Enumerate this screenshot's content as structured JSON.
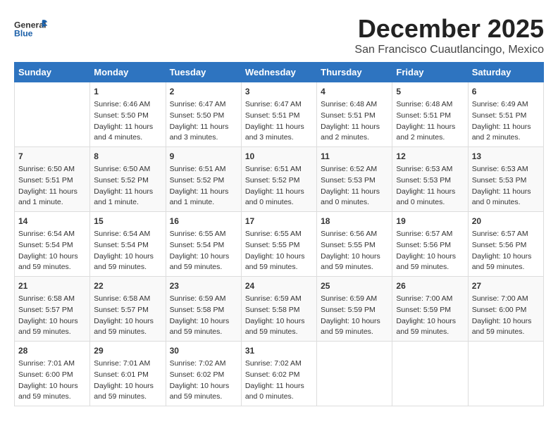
{
  "header": {
    "logo_general": "General",
    "logo_blue": "Blue",
    "month": "December 2025",
    "location": "San Francisco Cuautlancingo, Mexico"
  },
  "columns": [
    "Sunday",
    "Monday",
    "Tuesday",
    "Wednesday",
    "Thursday",
    "Friday",
    "Saturday"
  ],
  "weeks": [
    [
      {
        "day": "",
        "info": ""
      },
      {
        "day": "1",
        "info": "Sunrise: 6:46 AM\nSunset: 5:50 PM\nDaylight: 11 hours\nand 4 minutes."
      },
      {
        "day": "2",
        "info": "Sunrise: 6:47 AM\nSunset: 5:50 PM\nDaylight: 11 hours\nand 3 minutes."
      },
      {
        "day": "3",
        "info": "Sunrise: 6:47 AM\nSunset: 5:51 PM\nDaylight: 11 hours\nand 3 minutes."
      },
      {
        "day": "4",
        "info": "Sunrise: 6:48 AM\nSunset: 5:51 PM\nDaylight: 11 hours\nand 2 minutes."
      },
      {
        "day": "5",
        "info": "Sunrise: 6:48 AM\nSunset: 5:51 PM\nDaylight: 11 hours\nand 2 minutes."
      },
      {
        "day": "6",
        "info": "Sunrise: 6:49 AM\nSunset: 5:51 PM\nDaylight: 11 hours\nand 2 minutes."
      }
    ],
    [
      {
        "day": "7",
        "info": "Sunrise: 6:50 AM\nSunset: 5:51 PM\nDaylight: 11 hours\nand 1 minute."
      },
      {
        "day": "8",
        "info": "Sunrise: 6:50 AM\nSunset: 5:52 PM\nDaylight: 11 hours\nand 1 minute."
      },
      {
        "day": "9",
        "info": "Sunrise: 6:51 AM\nSunset: 5:52 PM\nDaylight: 11 hours\nand 1 minute."
      },
      {
        "day": "10",
        "info": "Sunrise: 6:51 AM\nSunset: 5:52 PM\nDaylight: 11 hours\nand 0 minutes."
      },
      {
        "day": "11",
        "info": "Sunrise: 6:52 AM\nSunset: 5:53 PM\nDaylight: 11 hours\nand 0 minutes."
      },
      {
        "day": "12",
        "info": "Sunrise: 6:53 AM\nSunset: 5:53 PM\nDaylight: 11 hours\nand 0 minutes."
      },
      {
        "day": "13",
        "info": "Sunrise: 6:53 AM\nSunset: 5:53 PM\nDaylight: 11 hours\nand 0 minutes."
      }
    ],
    [
      {
        "day": "14",
        "info": "Sunrise: 6:54 AM\nSunset: 5:54 PM\nDaylight: 10 hours\nand 59 minutes."
      },
      {
        "day": "15",
        "info": "Sunrise: 6:54 AM\nSunset: 5:54 PM\nDaylight: 10 hours\nand 59 minutes."
      },
      {
        "day": "16",
        "info": "Sunrise: 6:55 AM\nSunset: 5:54 PM\nDaylight: 10 hours\nand 59 minutes."
      },
      {
        "day": "17",
        "info": "Sunrise: 6:55 AM\nSunset: 5:55 PM\nDaylight: 10 hours\nand 59 minutes."
      },
      {
        "day": "18",
        "info": "Sunrise: 6:56 AM\nSunset: 5:55 PM\nDaylight: 10 hours\nand 59 minutes."
      },
      {
        "day": "19",
        "info": "Sunrise: 6:57 AM\nSunset: 5:56 PM\nDaylight: 10 hours\nand 59 minutes."
      },
      {
        "day": "20",
        "info": "Sunrise: 6:57 AM\nSunset: 5:56 PM\nDaylight: 10 hours\nand 59 minutes."
      }
    ],
    [
      {
        "day": "21",
        "info": "Sunrise: 6:58 AM\nSunset: 5:57 PM\nDaylight: 10 hours\nand 59 minutes."
      },
      {
        "day": "22",
        "info": "Sunrise: 6:58 AM\nSunset: 5:57 PM\nDaylight: 10 hours\nand 59 minutes."
      },
      {
        "day": "23",
        "info": "Sunrise: 6:59 AM\nSunset: 5:58 PM\nDaylight: 10 hours\nand 59 minutes."
      },
      {
        "day": "24",
        "info": "Sunrise: 6:59 AM\nSunset: 5:58 PM\nDaylight: 10 hours\nand 59 minutes."
      },
      {
        "day": "25",
        "info": "Sunrise: 6:59 AM\nSunset: 5:59 PM\nDaylight: 10 hours\nand 59 minutes."
      },
      {
        "day": "26",
        "info": "Sunrise: 7:00 AM\nSunset: 5:59 PM\nDaylight: 10 hours\nand 59 minutes."
      },
      {
        "day": "27",
        "info": "Sunrise: 7:00 AM\nSunset: 6:00 PM\nDaylight: 10 hours\nand 59 minutes."
      }
    ],
    [
      {
        "day": "28",
        "info": "Sunrise: 7:01 AM\nSunset: 6:00 PM\nDaylight: 10 hours\nand 59 minutes."
      },
      {
        "day": "29",
        "info": "Sunrise: 7:01 AM\nSunset: 6:01 PM\nDaylight: 10 hours\nand 59 minutes."
      },
      {
        "day": "30",
        "info": "Sunrise: 7:02 AM\nSunset: 6:02 PM\nDaylight: 10 hours\nand 59 minutes."
      },
      {
        "day": "31",
        "info": "Sunrise: 7:02 AM\nSunset: 6:02 PM\nDaylight: 11 hours\nand 0 minutes."
      },
      {
        "day": "",
        "info": ""
      },
      {
        "day": "",
        "info": ""
      },
      {
        "day": "",
        "info": ""
      }
    ]
  ]
}
